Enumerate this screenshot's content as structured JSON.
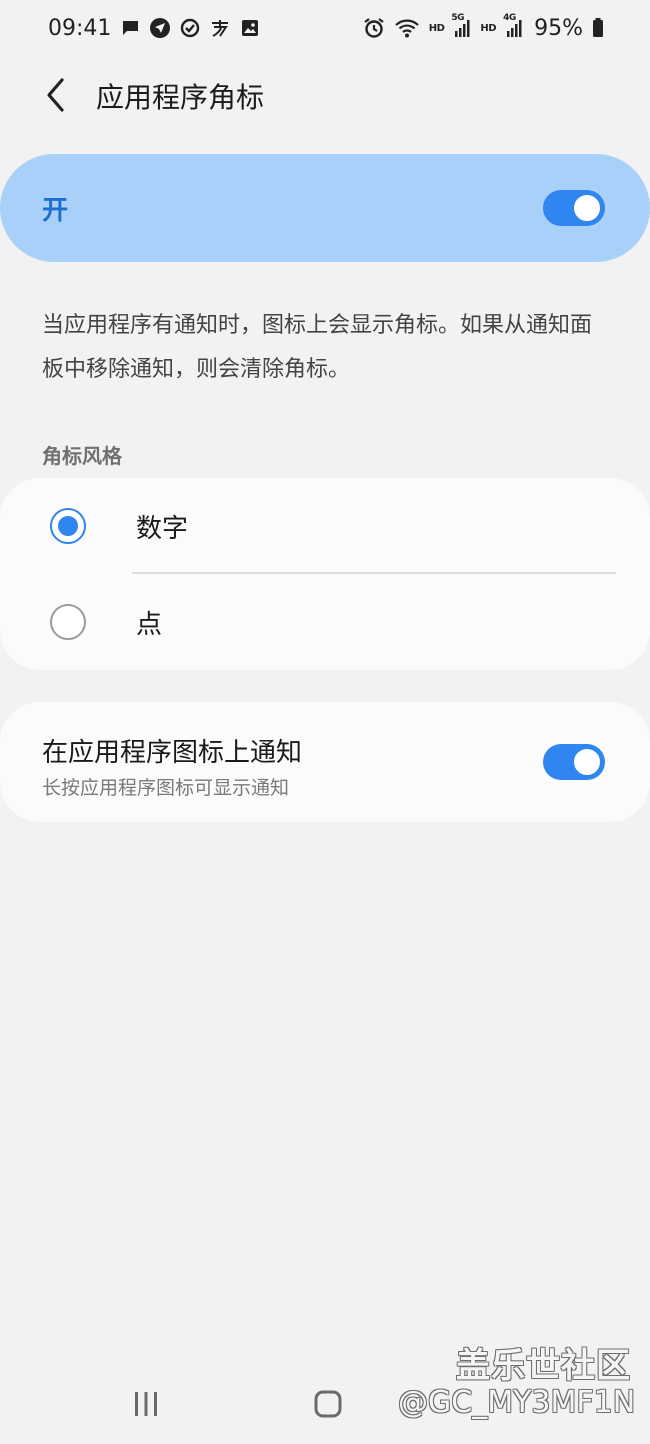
{
  "status_bar": {
    "time": "09:41",
    "notification_icons": [
      "message-icon",
      "location-icon",
      "check-circle-icon",
      "alipay-icon",
      "image-icon"
    ],
    "system_icons": [
      "alarm-icon",
      "wifi-icon",
      "signal-5g-icon",
      "signal-4g-icon",
      "battery-icon"
    ],
    "hd_label_1": "HD",
    "net_label_1": "5G",
    "hd_label_2": "HD",
    "net_label_2": "4G",
    "battery_percent": "95%"
  },
  "header": {
    "title": "应用程序角标"
  },
  "master_switch": {
    "label": "开",
    "enabled": true
  },
  "description": "当应用程序有通知时，图标上会显示角标。如果从通知面板中移除通知，则会清除角标。",
  "badge_style": {
    "section_title": "角标风格",
    "options": [
      {
        "label": "数字",
        "selected": true
      },
      {
        "label": "点",
        "selected": false
      }
    ]
  },
  "app_icon_notifications": {
    "title": "在应用程序图标上通知",
    "subtitle": "长按应用程序图标可显示通知",
    "enabled": true
  },
  "watermark": {
    "brand": "盖乐世社区",
    "user": "@GC_MY3MF1N"
  },
  "nav_bar": {
    "buttons": [
      "recents-icon",
      "home-icon"
    ]
  },
  "colors": {
    "accent": "#2f86f0",
    "master_bg": "#a9d0f8",
    "master_text": "#1f6fd0",
    "page_bg": "#f2f2f2",
    "card_bg": "#fbfbfb"
  }
}
